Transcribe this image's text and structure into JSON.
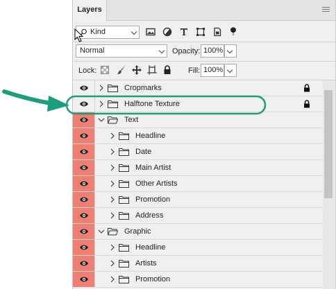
{
  "panel": {
    "tab_label": "Layers",
    "menu_icon": "hamburger-icon"
  },
  "filter": {
    "kind_label": "Kind",
    "search_icon": "search-icon",
    "icons": [
      "image-icon",
      "adjustment-icon",
      "type-icon",
      "shape-icon",
      "smart-object-icon",
      "filter-toggle-icon"
    ]
  },
  "blend": {
    "mode": "Normal",
    "opacity_label": "Opacity:",
    "opacity_value": "100%"
  },
  "lock": {
    "label": "Lock:",
    "icons": [
      "lock-transparent-icon",
      "lock-image-icon",
      "lock-position-icon",
      "lock-artboard-icon",
      "lock-all-icon"
    ],
    "fill_label": "Fill:",
    "fill_value": "100%"
  },
  "layers": [
    {
      "name": "Cropmarks",
      "level": 0,
      "expanded": false,
      "locked": true,
      "red": false
    },
    {
      "name": "Halftone Texture",
      "level": 0,
      "expanded": false,
      "locked": true,
      "red": false,
      "highlighted": true
    },
    {
      "name": "Text",
      "level": 0,
      "expanded": true,
      "locked": false,
      "red": true
    },
    {
      "name": "Headline",
      "level": 1,
      "expanded": false,
      "locked": false,
      "red": true
    },
    {
      "name": "Date",
      "level": 1,
      "expanded": false,
      "locked": false,
      "red": true
    },
    {
      "name": "Main Artist",
      "level": 1,
      "expanded": false,
      "locked": false,
      "red": true
    },
    {
      "name": "Other Artists",
      "level": 1,
      "expanded": false,
      "locked": false,
      "red": true
    },
    {
      "name": "Promotion",
      "level": 1,
      "expanded": false,
      "locked": false,
      "red": true
    },
    {
      "name": "Address",
      "level": 1,
      "expanded": false,
      "locked": false,
      "red": true
    },
    {
      "name": "Graphic",
      "level": 0,
      "expanded": true,
      "locked": false,
      "red": true
    },
    {
      "name": "Headline",
      "level": 1,
      "expanded": false,
      "locked": false,
      "red": true
    },
    {
      "name": "Artists",
      "level": 1,
      "expanded": false,
      "locked": false,
      "red": true
    },
    {
      "name": "Promotion",
      "level": 1,
      "expanded": false,
      "locked": false,
      "red": true
    }
  ],
  "annotation": {
    "color": "#1a9e7c"
  }
}
